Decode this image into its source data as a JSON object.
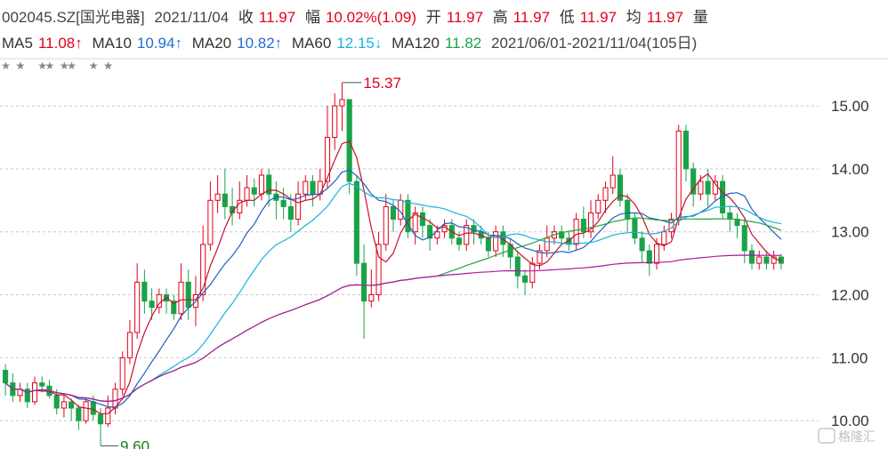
{
  "header": {
    "code_name": "002045.SZ[国光电器]",
    "date": "2021/11/04",
    "close_label": "收",
    "close_value": "11.97",
    "change_label": "幅",
    "change_value": "10.02%(1.09)",
    "open_label": "开",
    "open_value": "11.97",
    "high_label": "高",
    "high_value": "11.97",
    "low_label": "低",
    "low_value": "11.97",
    "avg_label": "均",
    "avg_value": "11.97",
    "volume_label": "量"
  },
  "ma_legend": {
    "ma5_label": "MA5",
    "ma5_value": "11.08↑",
    "ma10_label": "MA10",
    "ma10_value": "10.94↑",
    "ma20_label": "MA20",
    "ma20_value": "10.82↑",
    "ma60_label": "MA60",
    "ma60_value": "12.15↓",
    "ma120_label": "MA120",
    "ma120_value": "11.82",
    "range": "2021/06/01-2021/11/04(105日)"
  },
  "watermark": "格隆汇",
  "colors": {
    "up": "#e2001a",
    "down": "#19a347",
    "ma5": "#c8102e",
    "ma10": "#1f5fbf",
    "ma20": "#1ab3d8",
    "ma60": "#22a33a",
    "ma120": "#b0169e",
    "grid": "#c9c9c9"
  },
  "chart_data": {
    "type": "candlestick",
    "yaxis_ticks": [
      "10.00",
      "11.00",
      "12.00",
      "13.00",
      "14.00",
      "15.00"
    ],
    "ylim": [
      9.55,
      15.75
    ],
    "annotations": [
      {
        "text": "15.37",
        "index": 46,
        "price": 15.37,
        "kind": "high"
      },
      {
        "text": "9.60",
        "index": 13,
        "price": 9.6,
        "kind": "low"
      }
    ],
    "candles": [
      [
        10.8,
        10.6,
        10.9,
        10.4
      ],
      [
        10.6,
        10.4,
        10.75,
        10.3
      ],
      [
        10.4,
        10.5,
        10.6,
        10.3
      ],
      [
        10.5,
        10.3,
        10.6,
        10.2
      ],
      [
        10.3,
        10.6,
        10.7,
        10.25
      ],
      [
        10.6,
        10.55,
        10.7,
        10.45
      ],
      [
        10.55,
        10.4,
        10.65,
        10.35
      ],
      [
        10.4,
        10.2,
        10.5,
        10.1
      ],
      [
        10.2,
        10.3,
        10.4,
        10.05
      ],
      [
        10.3,
        10.2,
        10.35,
        10.0
      ],
      [
        10.2,
        10.0,
        10.25,
        9.85
      ],
      [
        10.0,
        10.3,
        10.35,
        9.95
      ],
      [
        10.3,
        10.1,
        10.4,
        10.0
      ],
      [
        10.1,
        9.95,
        10.2,
        9.6
      ],
      [
        9.95,
        10.2,
        10.4,
        9.9
      ],
      [
        10.2,
        10.5,
        10.6,
        10.1
      ],
      [
        10.5,
        11.0,
        11.1,
        10.4
      ],
      [
        11.0,
        11.4,
        11.6,
        10.9
      ],
      [
        11.4,
        12.2,
        12.5,
        11.3
      ],
      [
        12.2,
        11.9,
        12.4,
        11.7
      ],
      [
        11.9,
        11.8,
        12.1,
        11.6
      ],
      [
        11.8,
        12.0,
        12.1,
        11.7
      ],
      [
        12.0,
        11.9,
        12.1,
        11.7
      ],
      [
        11.9,
        11.7,
        12.0,
        11.6
      ],
      [
        11.7,
        12.2,
        12.5,
        11.6
      ],
      [
        12.2,
        11.8,
        12.4,
        11.6
      ],
      [
        11.8,
        12.0,
        12.3,
        11.5
      ],
      [
        12.0,
        12.8,
        13.1,
        11.9
      ],
      [
        12.8,
        13.5,
        13.8,
        12.7
      ],
      [
        13.5,
        13.6,
        13.9,
        13.3
      ],
      [
        13.6,
        13.4,
        14.0,
        13.2
      ],
      [
        13.4,
        13.3,
        13.7,
        13.1
      ],
      [
        13.3,
        13.5,
        13.8,
        13.2
      ],
      [
        13.5,
        13.7,
        13.9,
        13.4
      ],
      [
        13.7,
        13.6,
        13.85,
        13.4
      ],
      [
        13.6,
        13.9,
        14.0,
        13.5
      ],
      [
        13.9,
        13.6,
        14.0,
        13.4
      ],
      [
        13.6,
        13.5,
        13.8,
        13.2
      ],
      [
        13.5,
        13.4,
        13.7,
        13.2
      ],
      [
        13.4,
        13.2,
        13.6,
        13.0
      ],
      [
        13.2,
        13.6,
        13.8,
        13.1
      ],
      [
        13.6,
        13.8,
        13.9,
        13.5
      ],
      [
        13.8,
        13.6,
        13.9,
        13.4
      ],
      [
        13.6,
        13.8,
        14.0,
        13.5
      ],
      [
        13.8,
        14.5,
        15.0,
        13.7
      ],
      [
        14.5,
        15.0,
        15.2,
        14.3
      ],
      [
        15.0,
        15.1,
        15.37,
        14.6
      ],
      [
        15.1,
        13.8,
        15.1,
        13.6
      ],
      [
        13.8,
        12.5,
        13.9,
        12.3
      ],
      [
        12.5,
        11.9,
        12.8,
        11.3
      ],
      [
        11.9,
        12.0,
        12.4,
        11.8
      ],
      [
        12.0,
        12.8,
        13.0,
        11.9
      ],
      [
        12.8,
        13.4,
        13.6,
        12.7
      ],
      [
        13.4,
        13.2,
        13.5,
        13.0
      ],
      [
        13.2,
        13.5,
        13.6,
        13.1
      ],
      [
        13.5,
        13.0,
        13.6,
        12.9
      ],
      [
        13.0,
        13.3,
        13.4,
        12.8
      ],
      [
        13.3,
        13.1,
        13.4,
        12.9
      ],
      [
        13.1,
        12.9,
        13.2,
        12.7
      ],
      [
        12.9,
        13.0,
        13.1,
        12.8
      ],
      [
        13.0,
        13.1,
        13.2,
        12.9
      ],
      [
        13.1,
        12.9,
        13.2,
        12.8
      ],
      [
        12.9,
        12.8,
        13.0,
        12.7
      ],
      [
        12.8,
        13.1,
        13.2,
        12.7
      ],
      [
        13.1,
        13.0,
        13.2,
        12.8
      ],
      [
        13.0,
        12.9,
        13.1,
        12.8
      ],
      [
        12.9,
        12.7,
        13.0,
        12.6
      ],
      [
        12.7,
        13.0,
        13.1,
        12.6
      ],
      [
        13.0,
        12.8,
        13.1,
        12.6
      ],
      [
        12.8,
        12.6,
        12.9,
        12.4
      ],
      [
        12.6,
        12.3,
        12.7,
        12.1
      ],
      [
        12.3,
        12.2,
        12.4,
        12.0
      ],
      [
        12.2,
        12.5,
        12.6,
        12.1
      ],
      [
        12.5,
        12.7,
        12.8,
        12.4
      ],
      [
        12.7,
        12.9,
        13.1,
        12.6
      ],
      [
        12.9,
        13.0,
        13.1,
        12.8
      ],
      [
        13.0,
        12.9,
        13.1,
        12.8
      ],
      [
        12.9,
        12.8,
        13.0,
        12.7
      ],
      [
        12.8,
        13.2,
        13.3,
        12.7
      ],
      [
        13.2,
        13.0,
        13.4,
        12.9
      ],
      [
        13.0,
        13.3,
        13.5,
        12.9
      ],
      [
        13.3,
        13.5,
        13.6,
        13.2
      ],
      [
        13.5,
        13.7,
        13.8,
        13.3
      ],
      [
        13.7,
        13.9,
        14.2,
        13.6
      ],
      [
        13.9,
        13.5,
        14.0,
        13.4
      ],
      [
        13.5,
        13.2,
        13.6,
        13.0
      ],
      [
        13.2,
        12.9,
        13.3,
        12.8
      ],
      [
        12.9,
        12.7,
        13.0,
        12.5
      ],
      [
        12.7,
        12.5,
        12.8,
        12.3
      ],
      [
        12.5,
        12.8,
        12.9,
        12.4
      ],
      [
        12.8,
        13.0,
        13.1,
        12.7
      ],
      [
        13.0,
        13.2,
        13.3,
        12.9
      ],
      [
        13.2,
        14.6,
        14.7,
        13.1
      ],
      [
        14.6,
        14.0,
        14.7,
        13.8
      ],
      [
        14.0,
        13.6,
        14.1,
        13.4
      ],
      [
        13.6,
        13.8,
        13.9,
        13.5
      ],
      [
        13.8,
        13.6,
        14.0,
        13.4
      ],
      [
        13.6,
        13.8,
        13.9,
        13.5
      ],
      [
        13.8,
        13.3,
        13.9,
        13.2
      ],
      [
        13.3,
        13.2,
        13.4,
        13.0
      ],
      [
        13.2,
        13.1,
        13.3,
        12.9
      ],
      [
        13.1,
        12.7,
        13.2,
        12.5
      ],
      [
        12.7,
        12.5,
        12.8,
        12.4
      ],
      [
        12.5,
        12.6,
        12.7,
        12.4
      ],
      [
        12.6,
        12.5,
        12.7,
        12.4
      ],
      [
        12.5,
        12.6,
        12.7,
        12.4
      ],
      [
        12.6,
        12.5,
        12.65,
        12.4
      ]
    ]
  }
}
